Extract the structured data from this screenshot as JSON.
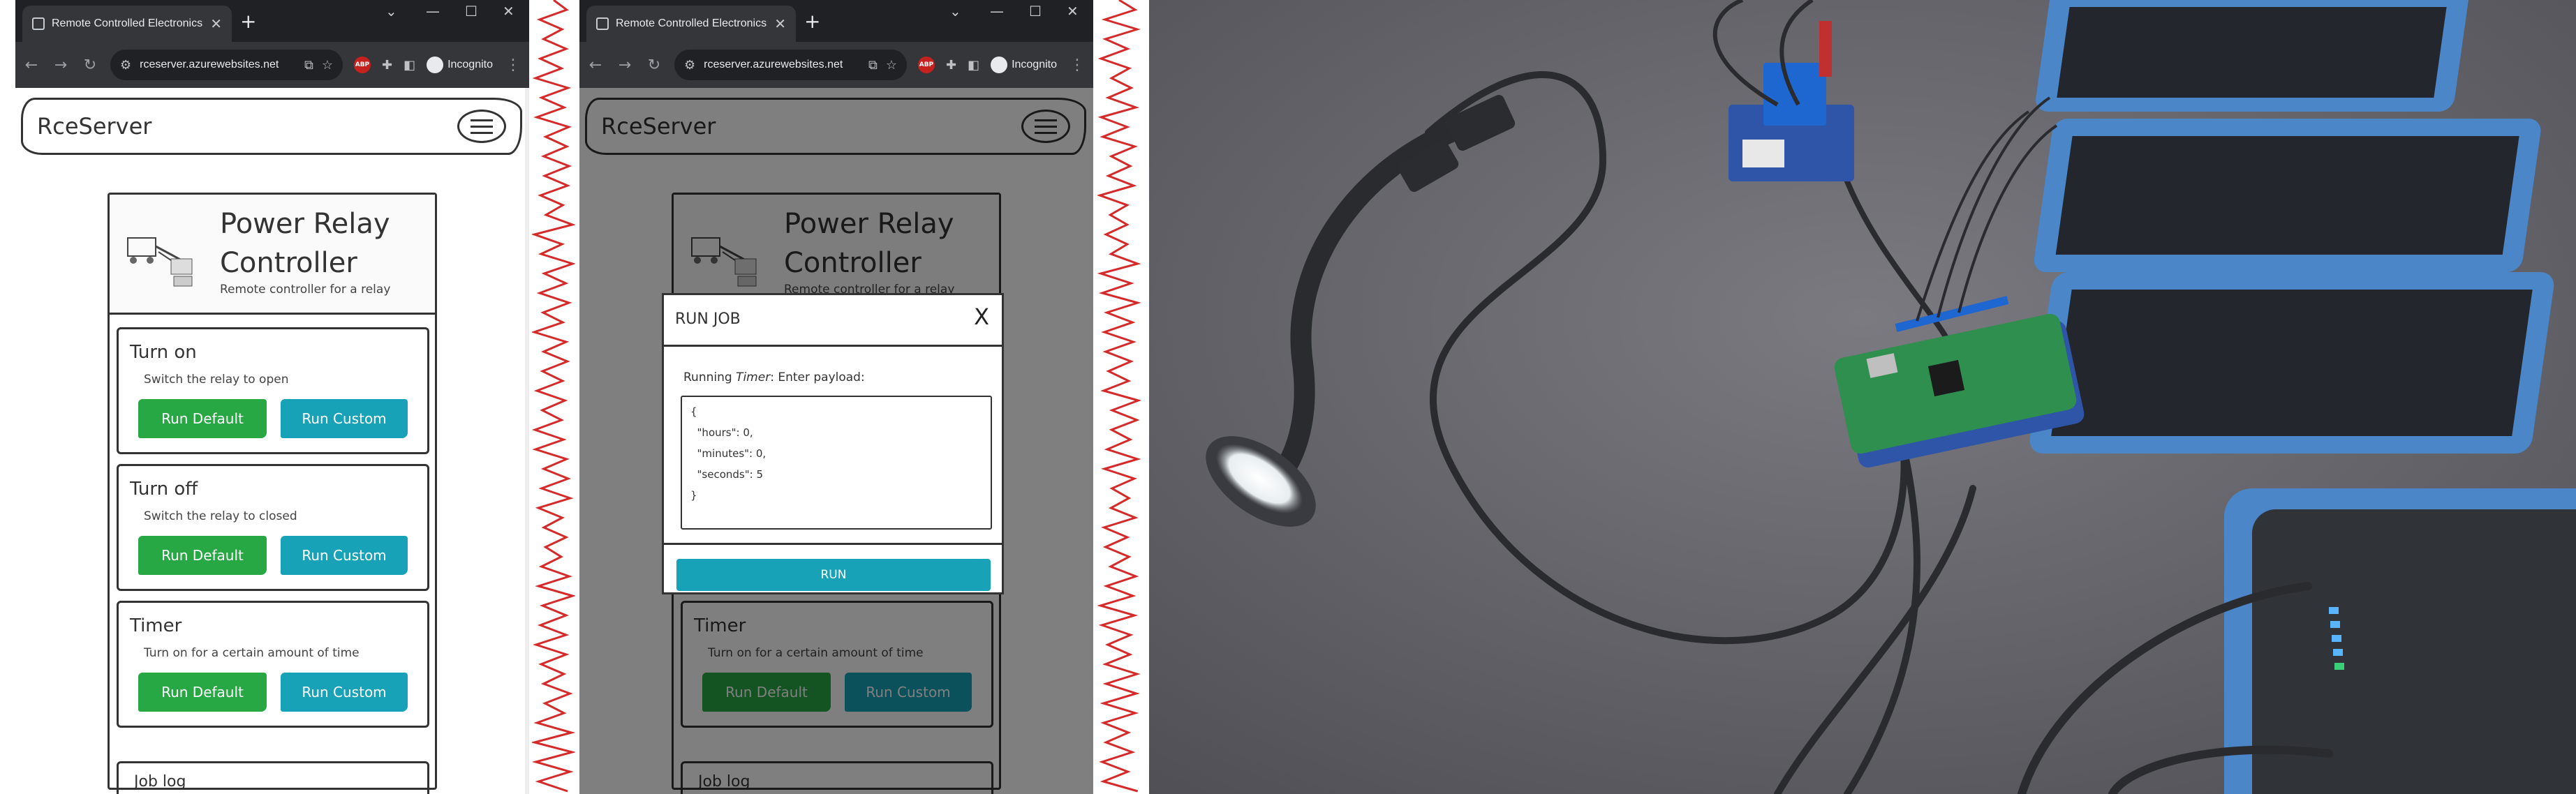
{
  "browser": {
    "tab_title": "Remote Controlled Electronics",
    "url": "rceserver.azurewebsites.net",
    "incognito_label": "Incognito",
    "adblock_label": "ABP"
  },
  "page": {
    "brand": "RceServer",
    "card": {
      "title": "Power Relay Controller",
      "subtitle": "Remote controller for a relay"
    },
    "jobs": [
      {
        "name": "Turn on",
        "description": "Switch the relay to open",
        "default_label": "Run Default",
        "custom_label": "Run Custom"
      },
      {
        "name": "Turn off",
        "description": "Switch the relay to closed",
        "default_label": "Run Default",
        "custom_label": "Run Custom"
      },
      {
        "name": "Timer",
        "description": "Turn on for a certain amount of time",
        "default_label": "Run Default",
        "custom_label": "Run Custom"
      }
    ],
    "job_log_label": "Job log"
  },
  "modal": {
    "title": "RUN JOB",
    "close_label": "X",
    "prompt_prefix": "Running ",
    "prompt_job": "Timer",
    "prompt_suffix": ": Enter payload:",
    "payload": "{\n  \"hours\": 0,\n  \"minutes\": 0,\n  \"seconds\": 5\n}",
    "run_label": "RUN"
  },
  "colors": {
    "chrome_dark": "#202124",
    "success_green": "#28a745",
    "info_teal": "#17a2b8",
    "divider_red": "#d42a2a",
    "solar_blue": "#4a86c8",
    "pcb_green": "#2f8f4e"
  }
}
